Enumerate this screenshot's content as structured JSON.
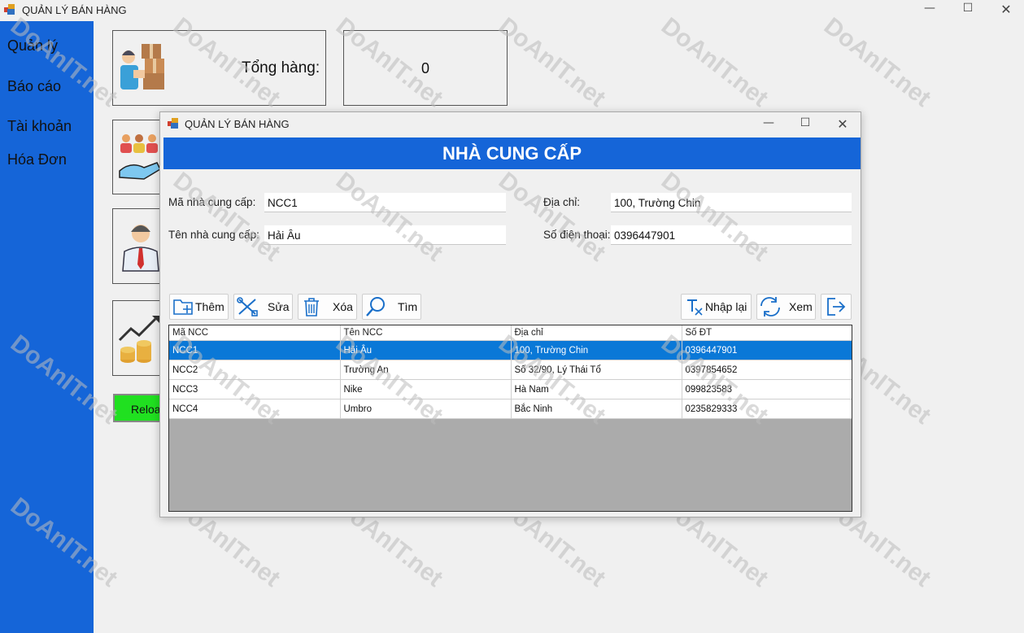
{
  "app": {
    "title": "QUẢN LÝ BÁN HÀNG"
  },
  "sidebar": {
    "items": [
      {
        "label": "Quản lý"
      },
      {
        "label": "Báo cáo"
      },
      {
        "label": "Tài khoản"
      },
      {
        "label": "Hóa Đơn"
      }
    ]
  },
  "summary": {
    "total_label": "Tổng hàng:",
    "total_value": "0"
  },
  "reload": {
    "label": "Reload"
  },
  "dialog": {
    "title": "QUẢN LÝ BÁN HÀNG",
    "heading": "NHÀ CUNG CẤP",
    "form": {
      "code_label": "Mã nhà cung cấp:",
      "code_value": "NCC1",
      "name_label": "Tên nhà cung cấp:",
      "name_value": "Hải Âu",
      "address_label": "Địa chỉ:",
      "address_value": "100, Trường Chin",
      "phone_label": "Số điện thoại:",
      "phone_value": "0396447901"
    },
    "toolbar": {
      "add": "Thêm",
      "edit": "Sửa",
      "delete": "Xóa",
      "search": "Tìm",
      "reset": "Nhập lại",
      "view": "Xem"
    },
    "grid": {
      "columns": [
        "Mã NCC",
        "Tên NCC",
        "Địa chỉ",
        "Số ĐT"
      ],
      "rows": [
        [
          "NCC1",
          "Hải Âu",
          "100, Trường Chin",
          "0396447901"
        ],
        [
          "NCC2",
          "Trường An",
          "Số 32/90, Lý Thái Tổ",
          "0397854652"
        ],
        [
          "NCC3",
          "Nike",
          "Hà Nam",
          "099823583"
        ],
        [
          "NCC4",
          "Umbro",
          "Bắc Ninh",
          "0235829333"
        ]
      ]
    }
  },
  "watermark": "DoAnIT.net",
  "colors": {
    "accent": "#1565d8",
    "selection": "#0a78d7",
    "reload": "#20e020"
  }
}
